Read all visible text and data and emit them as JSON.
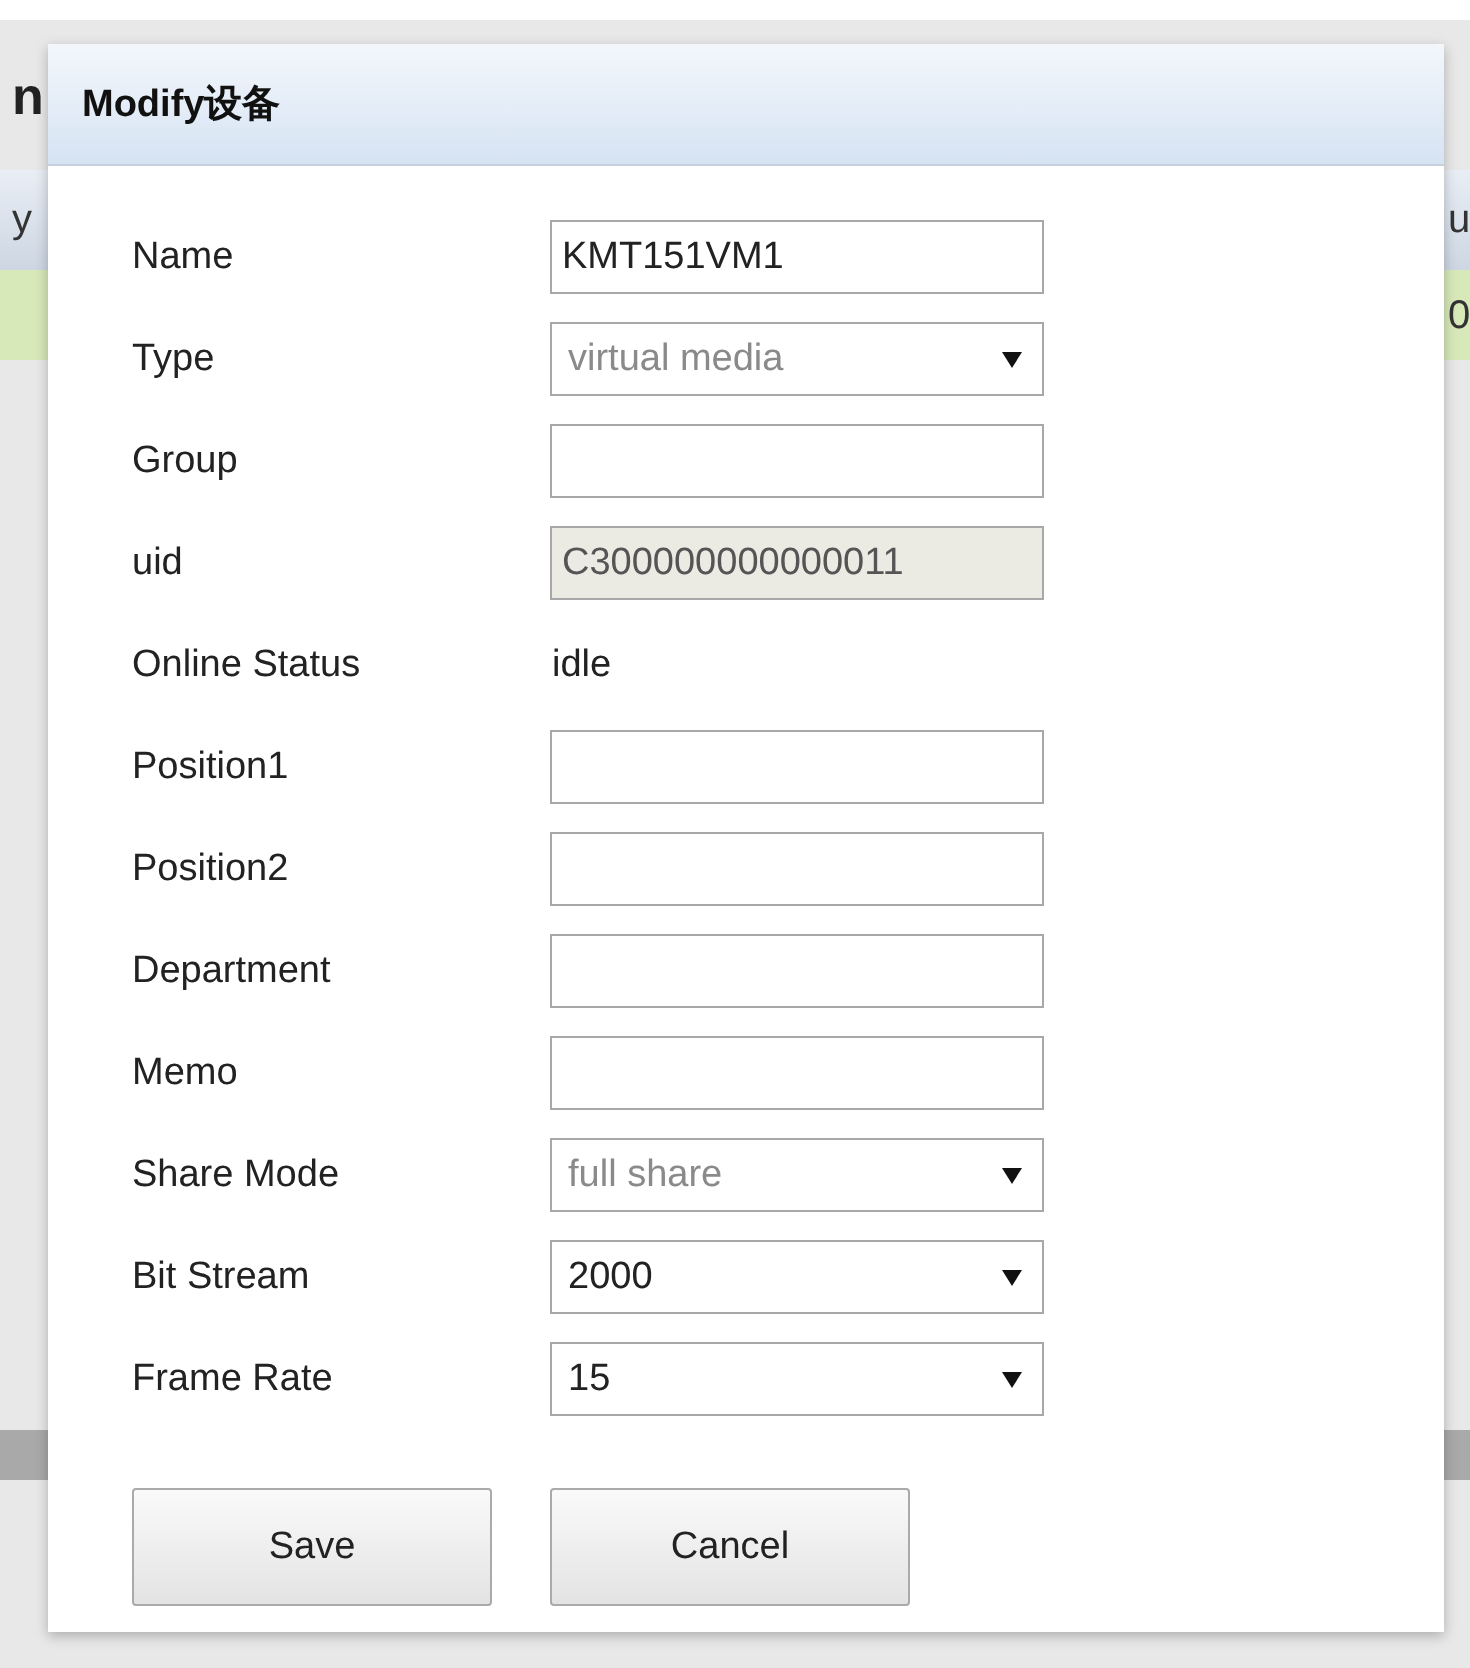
{
  "background": {
    "left": {
      "title": "n",
      "column_header": "y"
    },
    "right": {
      "column_header": "u",
      "cell": "0"
    }
  },
  "dialog": {
    "title": "Modify设备",
    "fields": [
      {
        "label": "Name",
        "kind": "text",
        "value": "KMT151VM1",
        "disabled": false
      },
      {
        "label": "Type",
        "kind": "select",
        "value": "virtual media",
        "disabled": true
      },
      {
        "label": "Group",
        "kind": "text",
        "disabled": false
      },
      {
        "label": "uid",
        "kind": "text",
        "value": "C300000000000011",
        "disabled": true
      },
      {
        "label": "Online Status",
        "kind": "static",
        "value": "idle"
      },
      {
        "label": "Position1",
        "kind": "text",
        "disabled": false
      },
      {
        "label": "Position2",
        "kind": "text",
        "disabled": false
      },
      {
        "label": "Department",
        "kind": "text",
        "disabled": false
      },
      {
        "label": "Memo",
        "kind": "text",
        "disabled": false
      },
      {
        "label": "Share Mode",
        "kind": "select",
        "value": "full share",
        "disabled": true
      },
      {
        "label": "Bit Stream",
        "kind": "select",
        "value": "2000",
        "disabled": false
      },
      {
        "label": "Frame Rate",
        "kind": "select",
        "value": "15",
        "disabled": false
      }
    ],
    "buttons": [
      "Save",
      "Cancel"
    ]
  }
}
